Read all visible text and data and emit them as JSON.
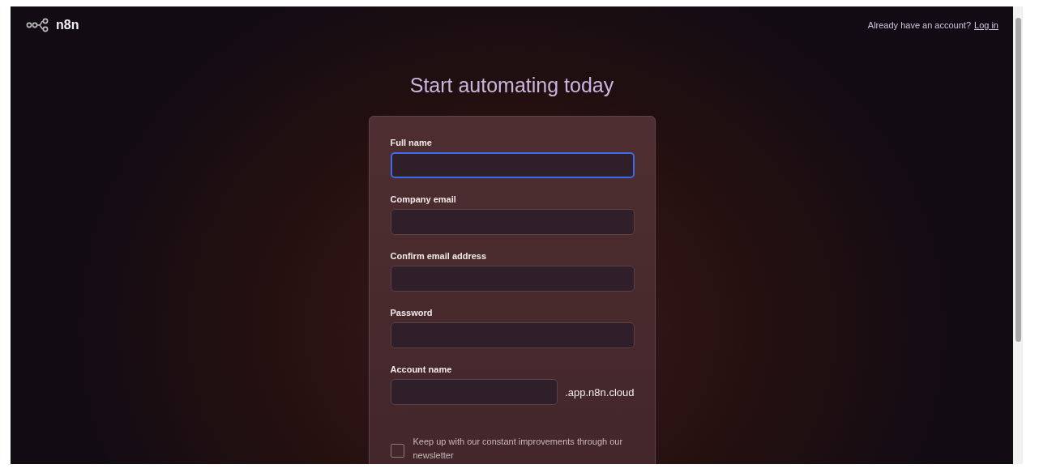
{
  "header": {
    "logo_text": "n8n",
    "login_prompt": "Already have an account?",
    "login_link": "Log in"
  },
  "title": "Start automating today",
  "form": {
    "fields": [
      {
        "label": "Full name",
        "focused": true
      },
      {
        "label": "Company email",
        "focused": false
      },
      {
        "label": "Confirm email address",
        "focused": false
      },
      {
        "label": "Password",
        "focused": false
      },
      {
        "label": "Account name",
        "focused": false,
        "suffix": ".app.n8n.cloud"
      }
    ],
    "newsletter": {
      "label": "Keep up with our constant improvements through our newsletter",
      "checked": false
    }
  }
}
